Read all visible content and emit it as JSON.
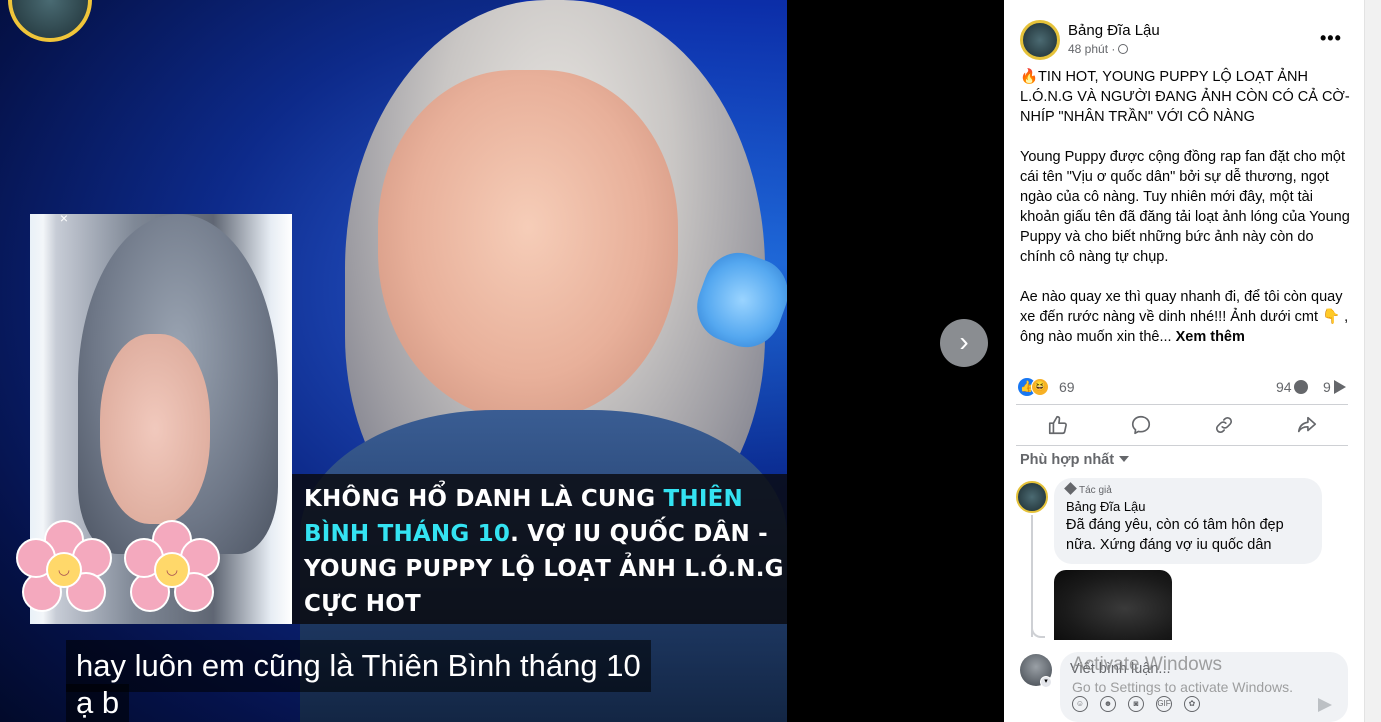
{
  "media": {
    "caption_lines": [
      [
        "KHÔNG HỔ DANH LÀ CUNG ",
        "THIÊN"
      ],
      [
        "BÌNH THÁNG 10",
        ". VỢ IU QUỐC DÂN -"
      ],
      [
        "YOUNG PUPPY LỘ LOẠT ẢNH L.Ó.N.G"
      ],
      [
        "CỰC HOT"
      ]
    ],
    "subtitle_line1": "hay luôn em cũng là Thiên Bình tháng 10",
    "subtitle_line2": "ạ b",
    "close_glyph": "×",
    "next_glyph": "›"
  },
  "post": {
    "page_name": "Bảng Đĩa Lậu",
    "time": "48 phút ·",
    "headline": "🔥TIN HOT, YOUNG PUPPY LỘ LOẠT ẢNH L.Ó.N.G VÀ NGƯỜI ĐANG ẢNH CÒN CÓ CẢ CỜ-NHÍP \"NHÂN TRẦN\" VỚI CÔ NÀNG",
    "paragraph1": "Young Puppy được cộng đồng rap fan đặt cho một cái tên \"Vịu ơ quốc dân\" bởi sự dễ thương, ngọt ngào của cô nàng. Tuy nhiên mới đây, một tài khoản giấu tên đã đăng tải loạt ảnh lóng của Young Puppy và cho biết những bức ảnh này còn do chính cô nàng tự chụp.",
    "paragraph2": "Ae nào quay xe thì quay nhanh đi, để tôi còn quay xe đến rước nàng về dinh nhé!!! Ảnh dưới cmt 👇 , ông nào muốn xin thê...",
    "see_more": "Xem thêm",
    "reaction_count": "69",
    "comment_count": "94",
    "share_count": "9",
    "more_icon_text": "•••"
  },
  "comments": {
    "sort_label": "Phù hợp nhất",
    "author_badge": "Tác giả",
    "author_name": "Bảng Đĩa Lậu",
    "text": "Đã đáng yêu, còn có tâm hôn đẹp nữa. Xứng đáng vợ iu quốc dân"
  },
  "reply": {
    "placeholder": "Viết bình luận...",
    "tools": [
      "☺",
      "☻",
      "◙",
      "GIF",
      "✿"
    ]
  },
  "watermark": {
    "title": "Activate Windows",
    "subtitle": "Go to Settings to activate Windows."
  },
  "colors": {
    "caption_cyan": "#34e3f2",
    "caption_yellow": "#f6e33a",
    "like_blue": "#1877f2",
    "author_ring": "#e5c23a"
  }
}
